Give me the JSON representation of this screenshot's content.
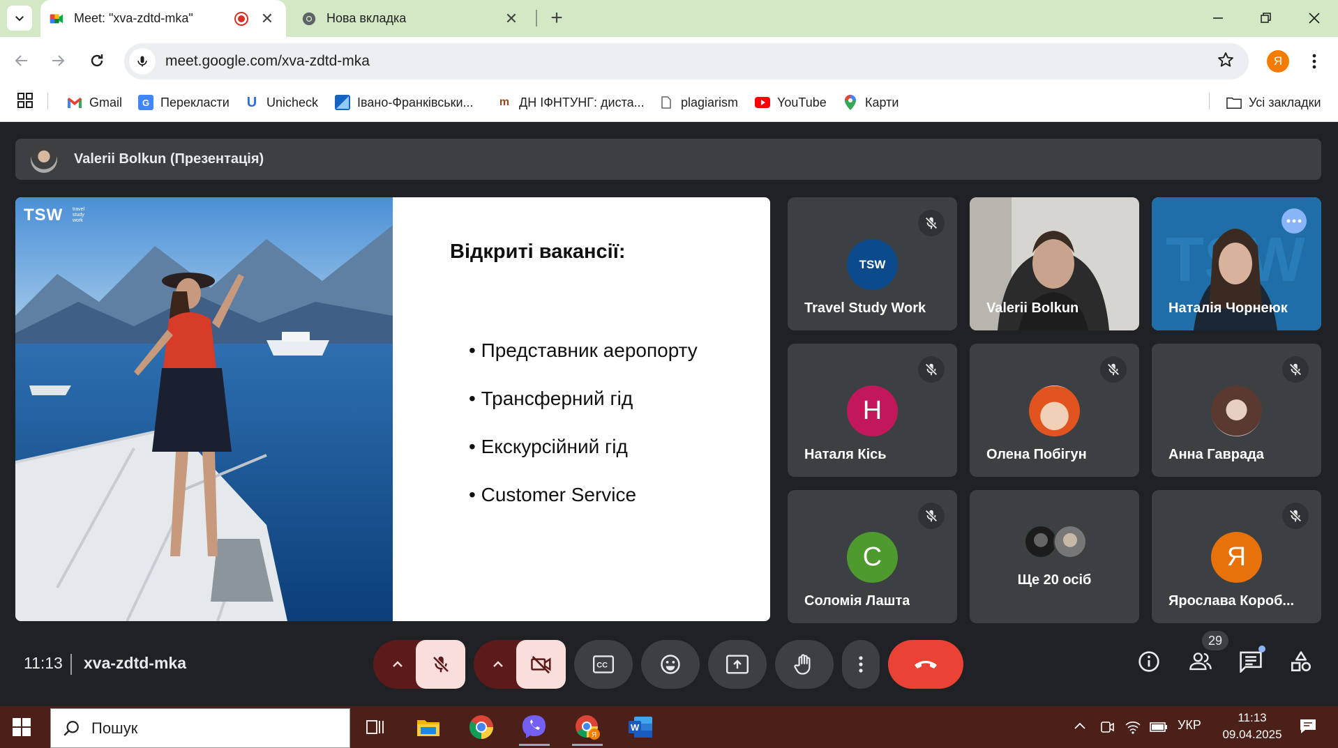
{
  "browser": {
    "tabs": [
      {
        "title": "Meet: \"xva-zdtd-mka\"",
        "active": true
      },
      {
        "title": "Нова вкладка",
        "active": false
      }
    ],
    "new_tab": "+",
    "close": "✕",
    "url": "meet.google.com/xva-zdtd-mka",
    "profile_letter": "Я",
    "window_controls": [
      "minimize",
      "restore",
      "close"
    ]
  },
  "bookmarks": {
    "items": [
      {
        "label": "Gmail",
        "icon": "gmail-icon"
      },
      {
        "label": "Перекласти",
        "icon": "translate-icon"
      },
      {
        "label": "Unicheck",
        "icon": "unicheck-icon"
      },
      {
        "label": "Івано-Франківськи...",
        "icon": "bookmark-icon"
      },
      {
        "label": "ДН ІФНТУНГ: диста...",
        "icon": "university-icon"
      },
      {
        "label": "plagiarism",
        "icon": "document-icon"
      },
      {
        "label": "YouTube",
        "icon": "youtube-icon"
      },
      {
        "label": "Карти",
        "icon": "maps-icon"
      }
    ],
    "all_bookmarks": "Усі закладки"
  },
  "meet": {
    "presenter": "Valerii Bolkun (Презентація)",
    "slide": {
      "logo": "TSW",
      "logo_small": "travel study work",
      "title": "Відкриті вакансії:",
      "bullets": [
        "Представник аеропорту",
        "Трансферний гід",
        "Екскурсійний гід",
        "Customer Service"
      ]
    },
    "participants": [
      {
        "name": "Travel Study Work",
        "avatar": "TSW",
        "color": "#0b4a8c",
        "muted": true
      },
      {
        "name": "Valerii Bolkun",
        "avatar": "",
        "color": "",
        "muted": false
      },
      {
        "name": "Наталія Чорнеюк",
        "avatar": "",
        "color": "",
        "muted": false
      },
      {
        "name": "Наталя Кісь",
        "avatar": "Н",
        "color": "#c2185b",
        "muted": true
      },
      {
        "name": "Олена Побігун",
        "avatar": "",
        "color": "#e76f2c",
        "muted": true
      },
      {
        "name": "Анна Гаврада",
        "avatar": "",
        "color": "#7a5a50",
        "muted": true
      },
      {
        "name": "Соломія Лашта",
        "avatar": "С",
        "color": "#4e9a2e",
        "muted": true
      },
      {
        "name": "Ще 20 осіб",
        "avatar": "",
        "color": "",
        "muted": false
      },
      {
        "name": "Ярослава Короб...",
        "avatar": "Я",
        "color": "#e8710a",
        "muted": true
      }
    ],
    "clock": "11:13",
    "meeting_code": "xva-zdtd-mka",
    "participant_count": "29",
    "colors": {
      "danger": "#ea4335",
      "dark_red": "#5c1a1a",
      "pale": "#f9dedc",
      "control": "#3c4043"
    }
  },
  "taskbar": {
    "search_placeholder": "Пошук",
    "lang": "УКР",
    "time": "11:13",
    "date": "09.04.2025"
  }
}
